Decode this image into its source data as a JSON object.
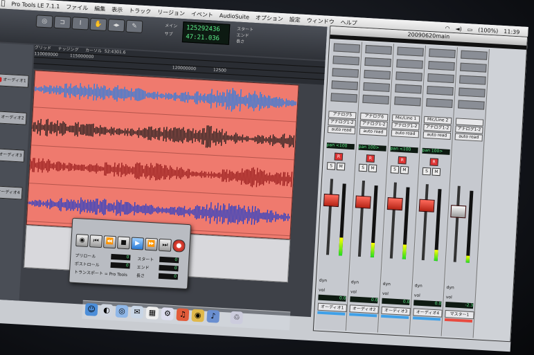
{
  "menubar": {
    "apple": "",
    "items": [
      "Pro Tools LE 7.1.1",
      "ファイル",
      "編集",
      "表示",
      "トラック",
      "リージョン",
      "イベント",
      "AudioSuite",
      "オプション",
      "設定",
      "ウィンドウ",
      "ヘルプ"
    ],
    "battery": "(100%)",
    "clock": "11:39"
  },
  "edit_window": {
    "counter_labels": [
      "メイン",
      "サブ"
    ],
    "counter_main": "125292436",
    "counter_sub": "47:21.036",
    "se_labels": [
      "スタート",
      "エンド",
      "長さ"
    ],
    "ruler_labels": [
      "グリッド",
      "ナッジング",
      "カーソル"
    ],
    "cursor_value": "52:4301.6",
    "ruler_ticks": [
      "110000000",
      "115000000",
      "120000000",
      "12500"
    ],
    "tracks": [
      "オーディオ1",
      "オーディオ2",
      "オーディオ3",
      "オーディオ4"
    ],
    "waveform_colors": [
      "#2f7de0",
      "#2a2020",
      "#9a1e1e",
      "#2840c8"
    ]
  },
  "transport": {
    "labels": [
      "プリロール",
      "ポストロール",
      "トランスポート = Pro Tools"
    ],
    "right_labels": [
      "スタート",
      "エンド",
      "長さ"
    ],
    "values": [
      "0",
      "0",
      "0",
      "0",
      "0"
    ]
  },
  "mix_window": {
    "title": "20090620main",
    "strips": [
      {
        "io_in": "アナログ5",
        "io_out": "アナログ1-2",
        "auto": "auto read",
        "pan": "pan  <100",
        "vol": "0.0",
        "name": "オーディオ1",
        "level": 0.25
      },
      {
        "io_in": "アナログ6",
        "io_out": "アナログ1-2",
        "auto": "auto read",
        "pan": "pan  100>",
        "vol": "0.0",
        "name": "オーディオ2",
        "level": 0.2
      },
      {
        "io_in": "Mic/Line 1",
        "io_out": "アナログ1-2",
        "auto": "auto read",
        "pan": "pan  <100",
        "vol": "0.0",
        "name": "オーディオ3",
        "level": 0.2
      },
      {
        "io_in": "Mic/Line 2",
        "io_out": "アナログ1-2",
        "auto": "auto read",
        "pan": "pan  100>",
        "vol": "0.0",
        "name": "オーディオ4",
        "level": 0.15
      },
      {
        "io_in": "",
        "io_out": "アナログ1-2",
        "auto": "auto read",
        "pan": "",
        "vol": "-2.3",
        "name": "マスター1",
        "level": 0.1
      }
    ],
    "buttons": {
      "rec": "R",
      "solo": "S",
      "mute": "M",
      "dyn": "dyn",
      "vol": "vol"
    }
  }
}
